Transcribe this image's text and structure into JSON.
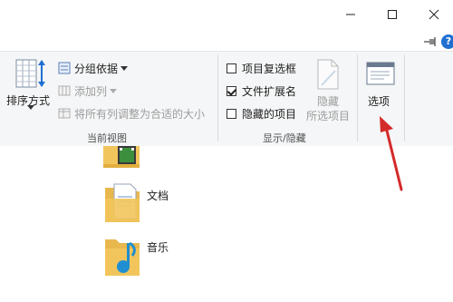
{
  "window_controls": {
    "minimize": "—",
    "maximize": "☐",
    "close": "✕"
  },
  "ribbon": {
    "current_view": {
      "group_label": "当前视图",
      "sort_by": "排序方式",
      "group_by": "分组依据",
      "add_columns": "添加列",
      "size_all_columns": "将所有列调整为合适的大小"
    },
    "show_hide": {
      "group_label": "显示/隐藏",
      "item_checkboxes": {
        "label": "项目复选框",
        "checked": false
      },
      "file_extensions": {
        "label": "文件扩展名",
        "checked": true
      },
      "hidden_items": {
        "label": "隐藏的项目",
        "checked": false
      },
      "hide_selected_line1": "隐藏",
      "hide_selected_line2": "所选项目"
    },
    "options": "选项"
  },
  "files": [
    {
      "name": "",
      "icon": "video-folder-icon"
    },
    {
      "name": "文档",
      "icon": "documents-folder-icon"
    },
    {
      "name": "音乐",
      "icon": "music-folder-icon"
    }
  ],
  "colors": {
    "arrow": "#d42a2a",
    "folder": "#f2c55c",
    "accent": "#1f6fd1"
  }
}
